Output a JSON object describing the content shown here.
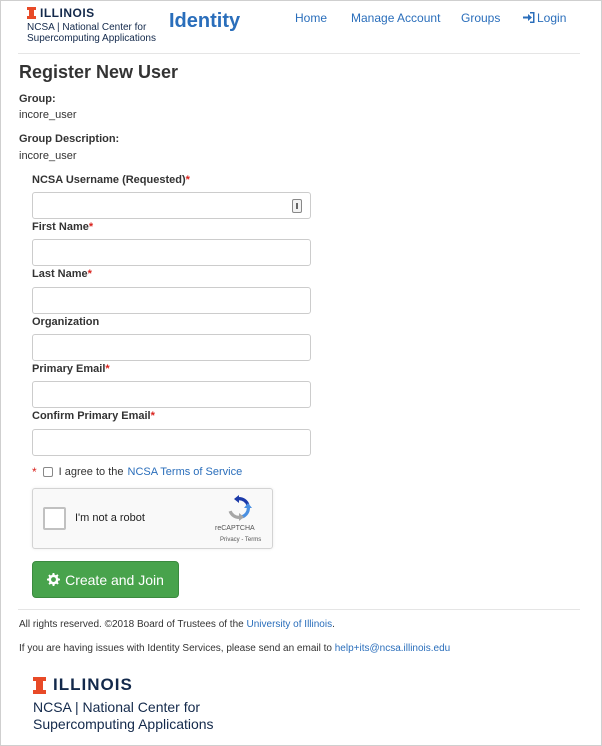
{
  "header": {
    "logo_name": "ILLINOIS",
    "logo_subtitle": "NCSA | National Center for Supercomputing Applications",
    "brand": "Identity",
    "nav": {
      "home": "Home",
      "manage": "Manage Account",
      "groups": "Groups",
      "login": "Login"
    }
  },
  "form": {
    "title": "Register New User",
    "group_label": "Group:",
    "group_value": "incore_user",
    "group_desc_label": "Group Description:",
    "group_desc_value": "incore_user",
    "required_marker": "*",
    "fields": {
      "username": {
        "label": "NCSA Username (Requested)",
        "value": ""
      },
      "first_name": {
        "label": "First Name",
        "value": ""
      },
      "last_name": {
        "label": "Last Name",
        "value": ""
      },
      "organization": {
        "label": "Organization",
        "value": ""
      },
      "email": {
        "label": "Primary Email",
        "value": ""
      },
      "confirm_email": {
        "label": "Confirm Primary Email",
        "value": ""
      }
    },
    "agree_text": "I agree to the",
    "terms_link": "NCSA Terms of Service",
    "captcha": {
      "text": "I'm not a robot",
      "brand": "reCAPTCHA",
      "links": "Privacy - Terms"
    },
    "submit": "Create and Join"
  },
  "footer": {
    "rights_prefix": "All rights reserved.  ©2018 Board of Trustees of the",
    "rights_link": "University of Illinois",
    "rights_suffix": ".",
    "help_prefix": "If you are having issues with Identity Services, please send an email to",
    "help_email": "help+its@ncsa.illinois.edu",
    "logo_name": "ILLINOIS",
    "logo_line1": "NCSA | National Center for",
    "logo_line2": "Supercomputing Applications"
  },
  "colors": {
    "accent": "#2a6ebb",
    "brand_orange": "#e84a27",
    "brand_navy": "#13294b",
    "required": "#d9231e",
    "button": "#48a34c"
  },
  "icons": {
    "login": "sign-in-icon",
    "button": "gear-icon",
    "captcha": "recaptcha-icon",
    "password_manager": "key-icon"
  }
}
